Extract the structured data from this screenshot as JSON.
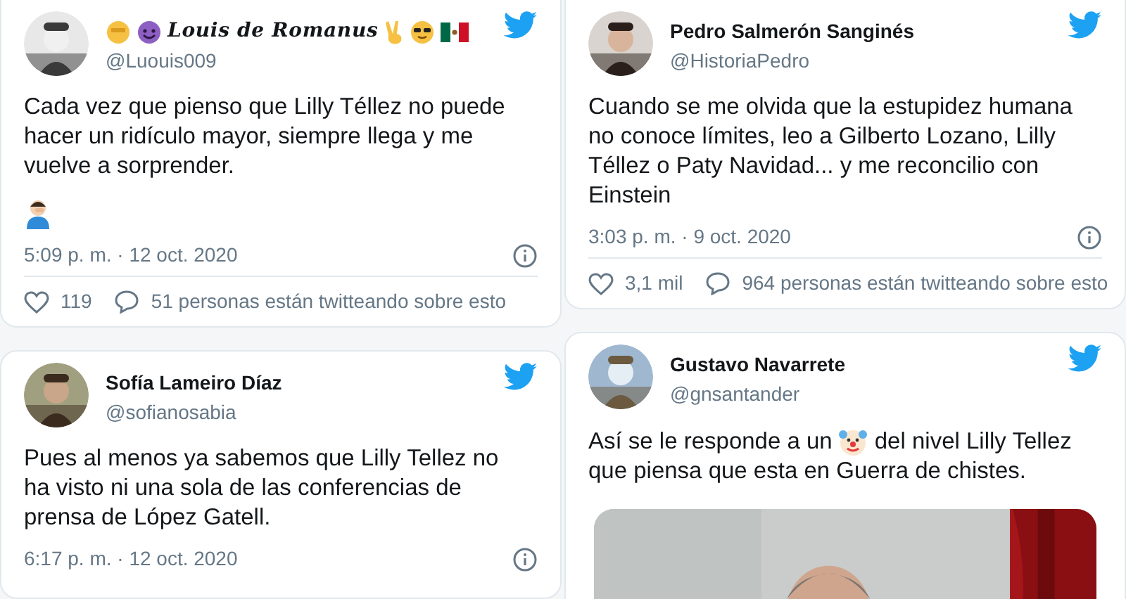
{
  "columns": [
    {
      "tweets": [
        {
          "kind": "decorated",
          "name": "Louis de Romanus",
          "handle": "@Luouis009",
          "text": [
            "Cada vez que pienso que Lilly Téllez no puede hacer un ridículo mayor, siempre llega y me vuelve a sorprender."
          ],
          "time": "5:09 p. m. · 12 oct. 2020",
          "likes": "119",
          "conversation": "51 personas están twitteando sobre esto",
          "avatar": {
            "kind": "picture"
          }
        },
        {
          "kind": "plain",
          "name": "Sofía Lameiro Díaz",
          "handle": "@sofianosabia",
          "text": [
            "Pues al menos ya sabemos que Lilly Tellez no ha visto ni una sola de las conferencias de prensa de López Gatell."
          ],
          "time": "6:17 p. m. · 12 oct. 2020",
          "avatar": {
            "kind": "picture"
          }
        }
      ]
    },
    {
      "tweets": [
        {
          "kind": "plain",
          "name": "Pedro Salmerón Sanginés",
          "handle": "@HistoriaPedro",
          "text": [
            "Cuando se me olvida que la estupidez humana no conoce límites, leo a Gilberto Lozano, Lilly Téllez o Paty Navidad... y me reconcilio con Einstein"
          ],
          "time": "3:03 p. m. · 9 oct. 2020",
          "likes": "3,1 mil",
          "conversation": "964 personas están twitteando sobre esto",
          "avatar": {
            "kind": "picture"
          }
        },
        {
          "kind": "plain",
          "name": "Gustavo Navarrete",
          "handle": "@gnsantander",
          "text": [
            "Así se le responde a un",
            "del nivel Lilly Tellez",
            "que piensa que esta en Guerra de chistes."
          ],
          "avatar": {
            "kind": "picture"
          },
          "media": {
            "kind": "picture"
          }
        }
      ]
    }
  ]
}
